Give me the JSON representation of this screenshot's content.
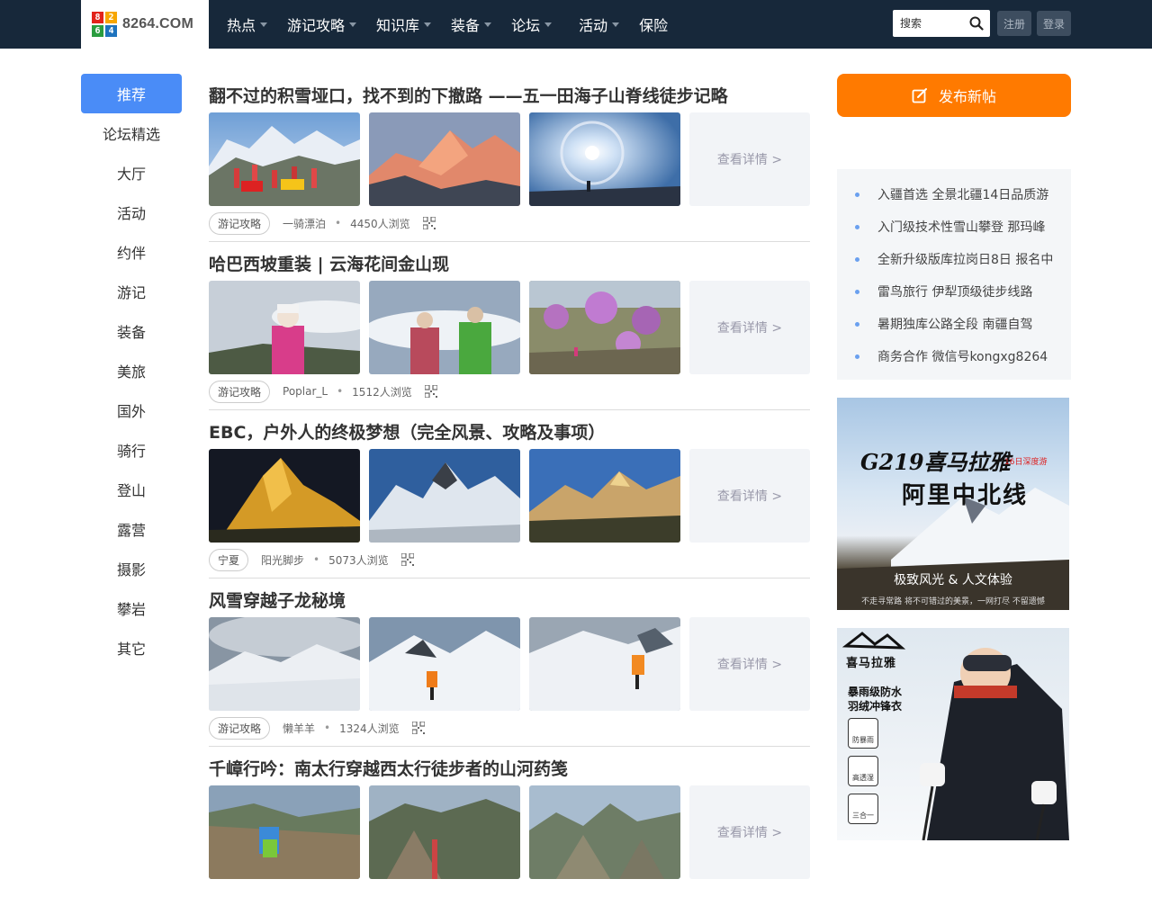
{
  "header": {
    "logo_digits": [
      "8",
      "2",
      "6",
      "4"
    ],
    "logo_text": "8264.COM",
    "nav": [
      {
        "label": "热点",
        "dropdown": true
      },
      {
        "label": "游记攻略",
        "dropdown": true
      },
      {
        "label": "知识库",
        "dropdown": true
      },
      {
        "label": "装备",
        "dropdown": true
      },
      {
        "label": "论坛",
        "dropdown": true
      },
      {
        "label": "活动",
        "dropdown": true
      },
      {
        "label": "保险",
        "dropdown": false
      }
    ],
    "search_placeholder": "搜索",
    "register": "注册",
    "login": "登录"
  },
  "sidebar": {
    "items": [
      "推荐",
      "论坛精选",
      "大厅",
      "活动",
      "约伴",
      "游记",
      "装备",
      "美旅",
      "国外",
      "骑行",
      "登山",
      "露营",
      "摄影",
      "攀岩",
      "其它"
    ],
    "active_index": 0
  },
  "posts": [
    {
      "title": "翻不过的积雪垭口，找不到的下撤路 ——五一田海子山脊线徒步记略",
      "more": "查看详情 >",
      "tag": "游记攻略",
      "author": "一骑漂泊",
      "views": "4450人浏览"
    },
    {
      "title": "哈巴西坡重装 | 云海花间金山现",
      "more": "查看详情 >",
      "tag": "游记攻略",
      "author": "Poplar_L",
      "views": "1512人浏览"
    },
    {
      "title": "EBC，户外人的终极梦想（完全风景、攻略及事项）",
      "more": "查看详情 >",
      "tag": "宁夏",
      "author": "阳光脚步",
      "views": "5073人浏览"
    },
    {
      "title": "风雪穿越子龙秘境",
      "more": "查看详情 >",
      "tag": "游记攻略",
      "author": "懒羊羊",
      "views": "1324人浏览"
    },
    {
      "title": "千嶂行吟：南太行穿越西太行徒步者的山河药笺",
      "more": "查看详情 >",
      "tag": "",
      "author": "",
      "views": ""
    }
  ],
  "right": {
    "publish_label": "发布新帖",
    "promos": [
      "入疆首选 全景北疆14日品质游",
      "入门级技术性雪山攀登 那玛峰",
      "全新升级版库拉岗日8日 报名中",
      "雷鸟旅行 伊犁顶级徒步线路",
      "暑期独库公路全段 南疆自驾",
      "商务合作 微信号kongxg8264"
    ],
    "ad1": {
      "line1": "G219喜马拉雅",
      "badge": "16日深度游",
      "line2": "阿里中北线",
      "slogan": "极致风光 & 人文体验",
      "footer": "不走寻常路 将不可错过的美景，一网打尽 不留遗憾"
    },
    "ad2": {
      "brand": "喜马拉雅",
      "text1": "暴雨级防水",
      "text2": "羽绒冲锋衣",
      "feature1": "防暴雨",
      "feature2": "高透湿",
      "feature3": "三合一"
    }
  },
  "colors": {
    "header_bg": "#17283a",
    "active_blue": "#4a8cf7",
    "publish_orange": "#ff7a00",
    "logo_cells": [
      "#e2231a",
      "#f7a600",
      "#2a9d3f",
      "#1e73be"
    ]
  }
}
